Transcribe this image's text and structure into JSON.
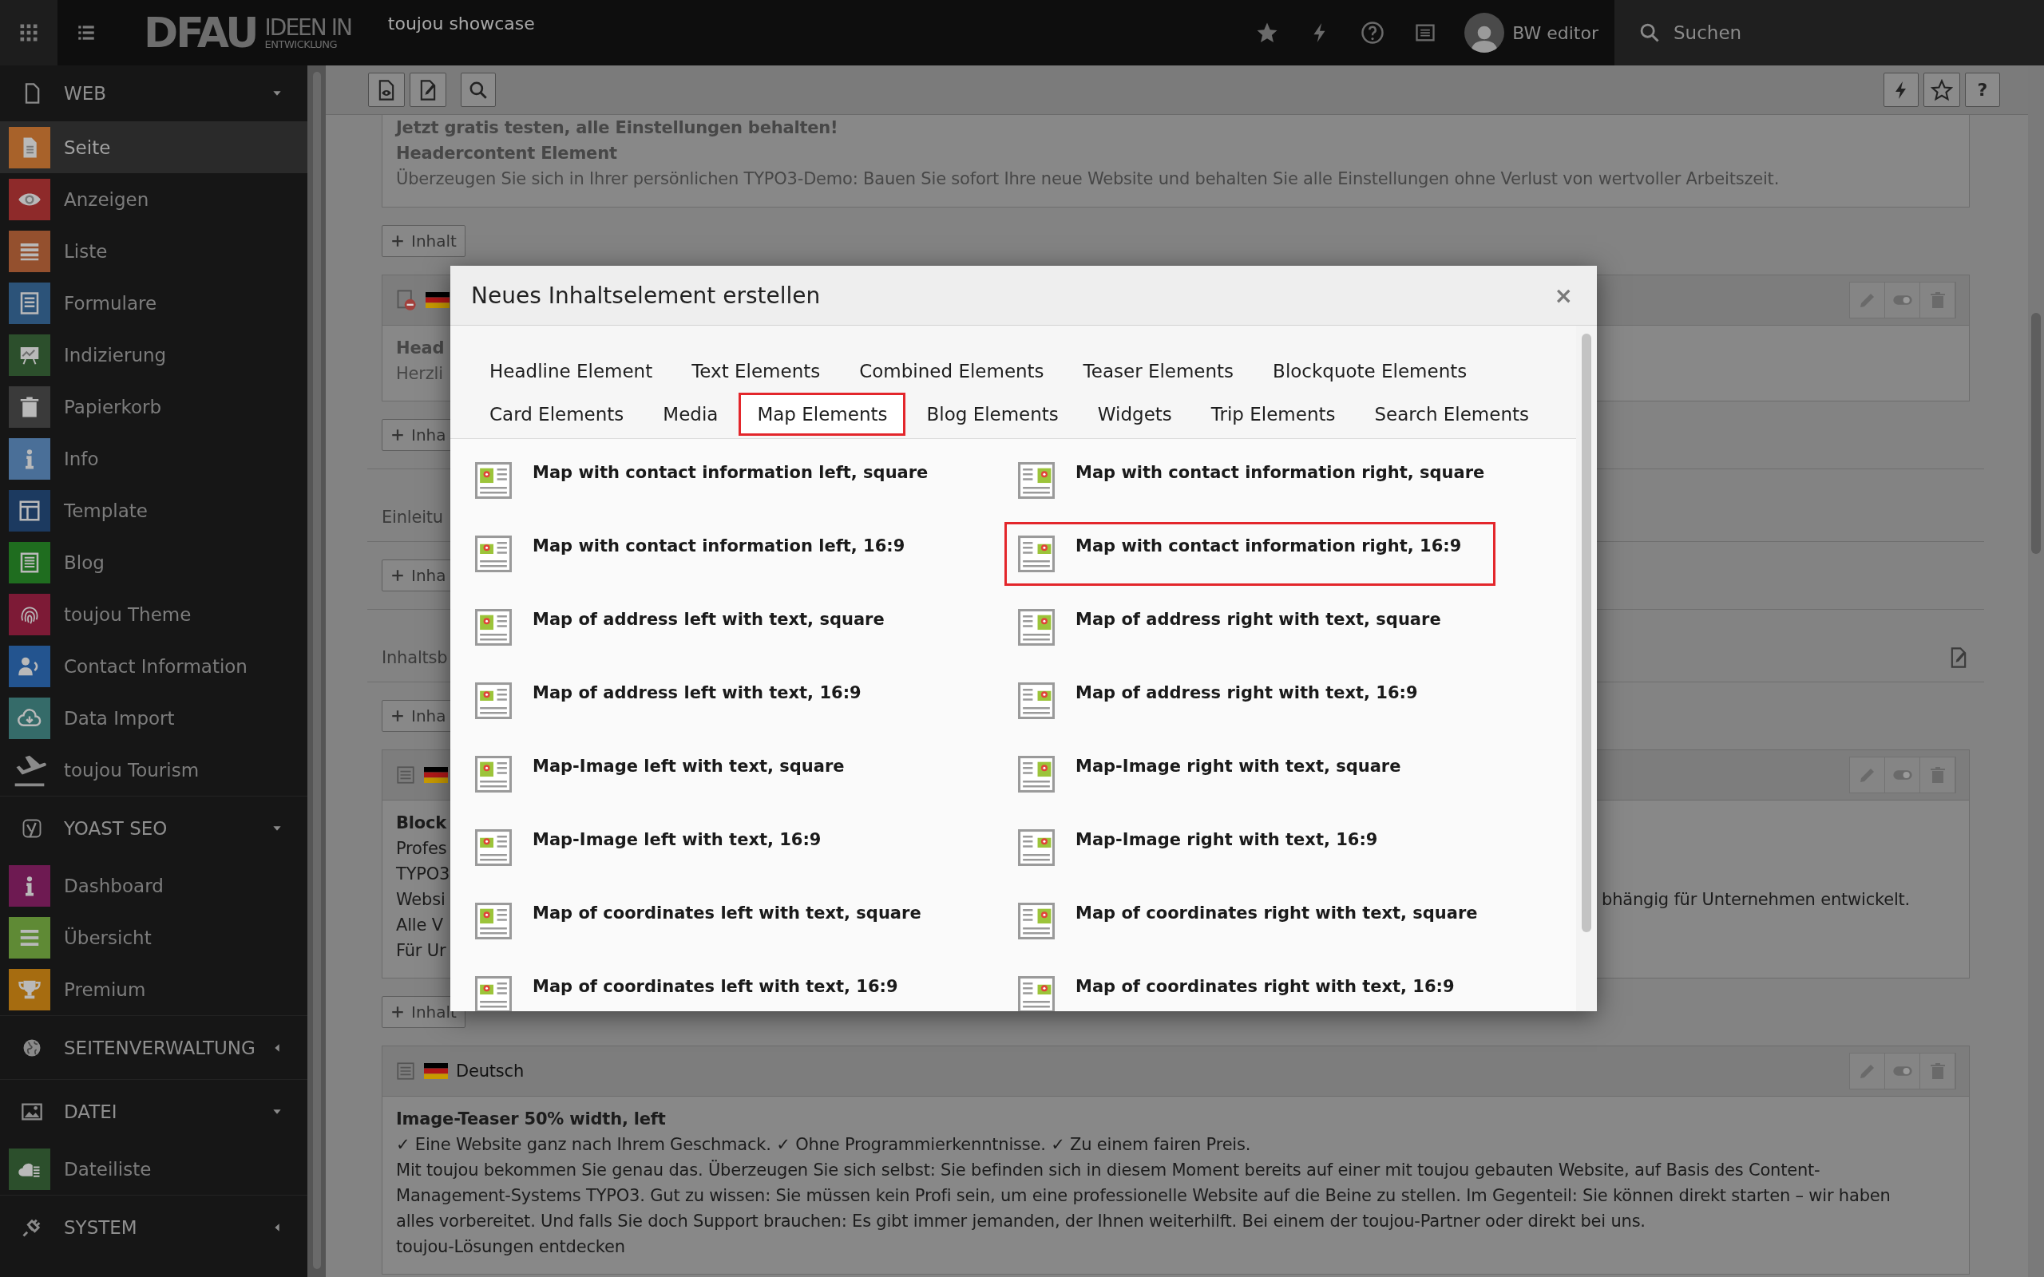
{
  "top_bar": {
    "logo": {
      "main": "DFAU",
      "tagline_1": "IDEEN IN",
      "tagline_2": "ENTWICKLUNG"
    },
    "site_name": "toujou showcase",
    "user": "BW editor",
    "search": {
      "placeholder": "Suchen"
    }
  },
  "sidebar": {
    "groups": [
      {
        "label": "WEB",
        "expanded": true,
        "items": [
          {
            "label": "Seite",
            "selected": true,
            "color": "#a8622a"
          },
          {
            "label": "Anzeigen",
            "selected": false,
            "color": "#8e2a2a"
          },
          {
            "label": "Liste",
            "selected": false,
            "color": "#94502e"
          },
          {
            "label": "Formulare",
            "selected": false,
            "color": "#2c5379"
          },
          {
            "label": "Indizierung",
            "selected": false,
            "color": "#2c4f2c"
          },
          {
            "label": "Papierkorb",
            "selected": false,
            "color": "#3a3a3a"
          },
          {
            "label": "Info",
            "selected": false,
            "color": "#4a6f98"
          },
          {
            "label": "Template",
            "selected": false,
            "color": "#1c3a60"
          },
          {
            "label": "Blog",
            "selected": false,
            "color": "#1f6d1f"
          },
          {
            "label": "toujou Theme",
            "selected": false,
            "color": "#7d1a36"
          },
          {
            "label": "Contact Information",
            "selected": false,
            "color": "#23548f"
          },
          {
            "label": "Data Import",
            "selected": false,
            "color": "#356b69"
          },
          {
            "label": "toujou Tourism",
            "selected": false
          }
        ]
      },
      {
        "label": "YOAST SEO",
        "expanded": true,
        "items": [
          {
            "label": "Dashboard",
            "selected": false,
            "color": "#6e1a52"
          },
          {
            "label": "Übersicht",
            "selected": false,
            "color": "#5f8a35"
          },
          {
            "label": "Premium",
            "selected": false,
            "color": "#a66c10"
          }
        ]
      },
      {
        "label": "SEITENVERWALTUNG",
        "expanded": false
      },
      {
        "label": "DATEI",
        "expanded": true,
        "items": [
          {
            "label": "Dateiliste",
            "selected": false,
            "color": "#2c4f2c"
          }
        ]
      },
      {
        "label": "SYSTEM",
        "expanded": false
      }
    ]
  },
  "doc_header": {
    "help_button": "?"
  },
  "content": [
    {
      "kind": "card",
      "hidden": true,
      "header": false,
      "lines": [
        {
          "text": "Jetzt gratis testen, alle Einstellungen behalten!",
          "bold": true
        },
        {
          "text": "Headercontent Element",
          "bold": true
        },
        {
          "text": "Überzeugen Sie sich in Ihrer persönlichen TYPO3-Demo: Bauen Sie sofort Ihre neue Website und behalten Sie alle Einstellungen ohne Verlust von wertvoller Arbeitszeit.",
          "bold": false
        }
      ]
    },
    {
      "kind": "add_button",
      "label": "Inhalt"
    },
    {
      "kind": "card",
      "hidden": true,
      "header": true,
      "lines": [
        {
          "text": "Head",
          "bold": true
        },
        {
          "text": "Herzli",
          "bold": false
        }
      ]
    },
    {
      "kind": "add_button",
      "label": "Inha"
    },
    {
      "kind": "section",
      "label": "Einleitu",
      "editable": false
    },
    {
      "kind": "add_button",
      "label": "Inha"
    },
    {
      "kind": "section",
      "label": "Inhaltsb",
      "editable": true
    },
    {
      "kind": "add_button",
      "label": "Inha"
    },
    {
      "kind": "card",
      "hidden": false,
      "header": true,
      "lines": [
        {
          "text": "Block",
          "bold": true
        },
        {
          "text": "Profes",
          "bold": false
        },
        {
          "text": "TYPO3",
          "bold": false
        },
        {
          "text": "Websi",
          "bold": false,
          "trailing": "bhängig für Unternehmen entwickelt."
        },
        {
          "text": "Alle V",
          "bold": false
        },
        {
          "text": "Für Ur",
          "bold": false
        }
      ]
    },
    {
      "kind": "add_button",
      "label": "Inhalt"
    },
    {
      "kind": "card",
      "hidden": false,
      "header": true,
      "header_label": "Deutsch",
      "lines": [
        {
          "text": "Image-Teaser 50% width, left",
          "bold": true
        },
        {
          "text": "✓ Eine Website ganz nach Ihrem Geschmack.  ✓ Ohne Programmierkenntnisse. ✓ Zu einem fairen Preis.",
          "bold": false
        },
        {
          "text": "Mit toujou bekommen Sie genau das. Überzeugen Sie sich selbst: Sie befinden sich in diesem Moment bereits auf einer mit toujou gebauten Website, auf Basis des Content-Management-Systems TYPO3. Gut zu wissen: Sie müssen kein Profi sein, um eine professionelle Website auf die Beine zu stellen. Im Gegenteil: Sie können direkt starten – wir haben alles vorbereitet. Und falls Sie doch Support brauchen: Es gibt immer jemanden, der Ihnen weiterhilft. Bei einem der toujou-Partner oder direkt bei uns.",
          "bold": false
        },
        {
          "text": "toujou-Lösungen entdecken",
          "bold": false
        }
      ]
    }
  ],
  "modal": {
    "title": "Neues Inhaltselement erstellen",
    "close": "×",
    "tab_rows": [
      [
        {
          "label": "Headline Element",
          "selected": false
        },
        {
          "label": "Text Elements",
          "selected": false
        },
        {
          "label": "Combined Elements",
          "selected": false
        },
        {
          "label": "Teaser Elements",
          "selected": false
        },
        {
          "label": "Blockquote Elements",
          "selected": false
        }
      ],
      [
        {
          "label": "Card Elements",
          "selected": false
        },
        {
          "label": "Media",
          "selected": false
        },
        {
          "label": "Map Elements",
          "selected": true
        },
        {
          "label": "Blog Elements",
          "selected": false
        },
        {
          "label": "Widgets",
          "selected": false
        },
        {
          "label": "Trip Elements",
          "selected": false
        },
        {
          "label": "Search Elements",
          "selected": false
        }
      ]
    ],
    "items": [
      {
        "title": "Map with contact information left, square",
        "selected": false
      },
      {
        "title": "Map with contact information right, square",
        "selected": false
      },
      {
        "title": "Map with contact information left, 16:9",
        "selected": false
      },
      {
        "title": "Map with contact information right, 16:9",
        "selected": true
      },
      {
        "title": "Map of address left with text, square",
        "selected": false
      },
      {
        "title": "Map of address right with text, square",
        "selected": false
      },
      {
        "title": "Map of address left with text, 16:9",
        "selected": false
      },
      {
        "title": "Map of address right with text, 16:9",
        "selected": false
      },
      {
        "title": "Map-Image left with text, square",
        "selected": false
      },
      {
        "title": "Map-Image right with text, square",
        "selected": false
      },
      {
        "title": "Map-Image left with text, 16:9",
        "selected": false
      },
      {
        "title": "Map-Image right with text, 16:9",
        "selected": false
      },
      {
        "title": "Map of coordinates left with text, square",
        "selected": false
      },
      {
        "title": "Map of coordinates right with text, square",
        "selected": false
      },
      {
        "title": "Map of coordinates left with text, 16:9",
        "selected": false
      },
      {
        "title": "Map of coordinates right with text, 16:9",
        "selected": false
      }
    ]
  }
}
